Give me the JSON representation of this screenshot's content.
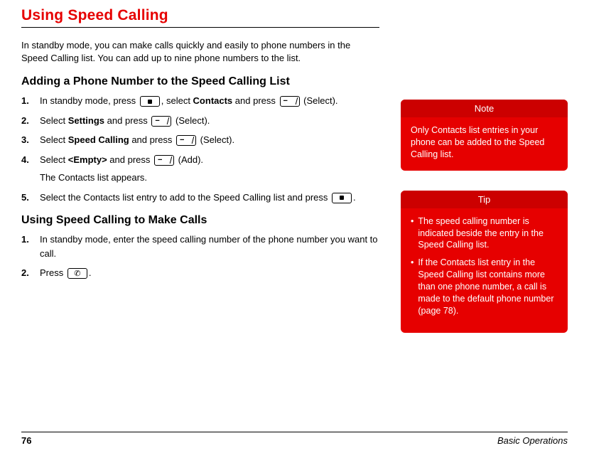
{
  "title": "Using Speed Calling",
  "intro": "In standby mode, you can make calls quickly and easily to phone numbers in the Speed Calling list. You can add up to nine phone numbers to the list.",
  "section1": {
    "heading": "Adding a Phone Number to the Speed Calling List",
    "steps": [
      {
        "n": "1.",
        "pre": "In standby mode, press ",
        "mid1": ", select ",
        "bold1": "Contacts",
        "mid2": " and press ",
        "post": " (Select)."
      },
      {
        "n": "2.",
        "pre": "Select ",
        "bold1": "Settings",
        "mid2": " and press ",
        "post": " (Select)."
      },
      {
        "n": "3.",
        "pre": "Select ",
        "bold1": "Speed Calling",
        "mid2": " and press ",
        "post": " (Select)."
      },
      {
        "n": "4.",
        "pre": "Select ",
        "bold1": "<Empty>",
        "mid2": " and press ",
        "post": " (Add).",
        "sub": "The Contacts list appears."
      },
      {
        "n": "5.",
        "pre": "Select the Contacts list entry to add to the Speed Calling list and press ",
        "post": "."
      }
    ]
  },
  "section2": {
    "heading": "Using Speed Calling to Make Calls",
    "steps": [
      {
        "n": "1.",
        "text": "In standby mode, enter the speed calling number of the phone number you want to call."
      },
      {
        "n": "2.",
        "pre": "Press ",
        "post": "."
      }
    ]
  },
  "note": {
    "header": "Note",
    "body": "Only Contacts list entries in your phone can be added to the Speed Calling list."
  },
  "tip": {
    "header": "Tip",
    "items": [
      "The speed calling number is indicated beside the entry in the Speed Calling list.",
      "If the Contacts list entry in the Speed Calling list contains more than one phone number, a call is made to the default phone number (page 78)."
    ]
  },
  "footer": {
    "page": "76",
    "chapter": "Basic Operations"
  }
}
